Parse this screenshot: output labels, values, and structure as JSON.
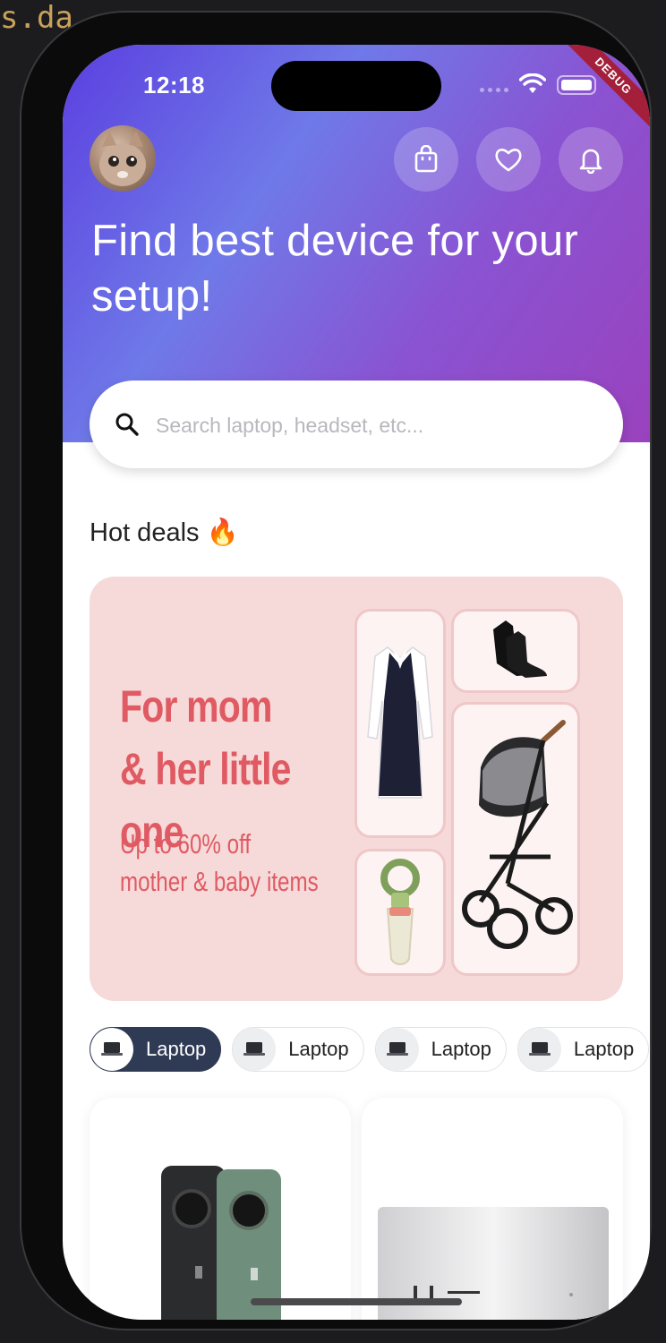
{
  "status_bar": {
    "time": "12:18",
    "debug_banner": "DEBUG"
  },
  "header": {
    "headline": "Find best device for your setup!"
  },
  "search": {
    "placeholder": "Search laptop, headset, etc..."
  },
  "hot_deals": {
    "title": "Hot deals 🔥",
    "banner": {
      "title": "For mom & her little one",
      "subtitle": "Up to 60% off mother & baby items"
    }
  },
  "categories": [
    {
      "label": "Laptop",
      "active": true
    },
    {
      "label": "Laptop",
      "active": false
    },
    {
      "label": "Laptop",
      "active": false
    },
    {
      "label": "Laptop",
      "active": false
    }
  ],
  "icons": {
    "avatar": "cat-avatar",
    "bag": "shopping-bag-icon",
    "heart": "heart-icon",
    "bell": "bell-icon",
    "search": "search-icon",
    "laptop": "laptop-icon"
  },
  "colors": {
    "active_chip": "#2f3a54",
    "banner_text": "#e05a63",
    "banner_bg": "#f6dad9"
  }
}
